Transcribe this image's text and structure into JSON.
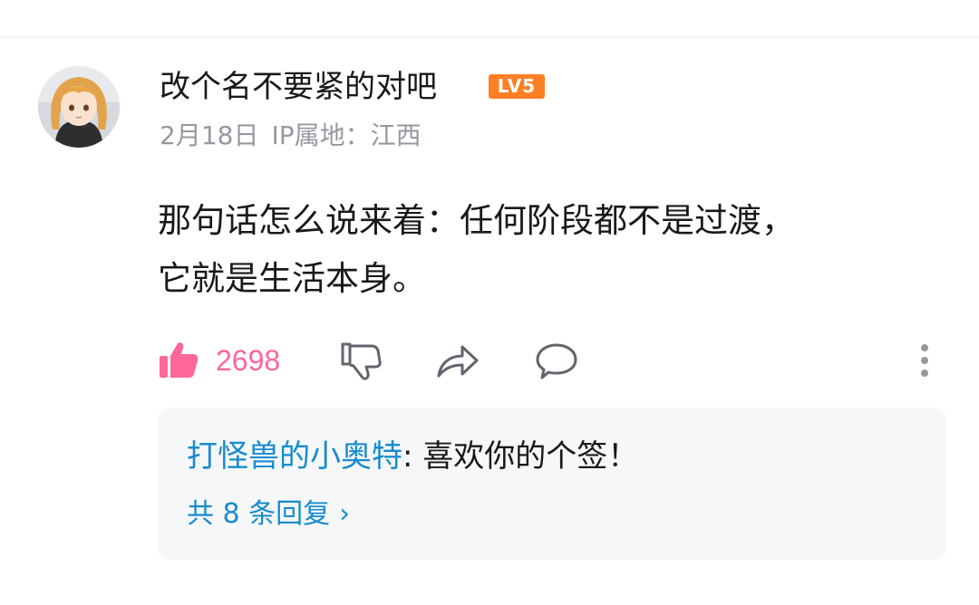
{
  "comment": {
    "username": "改个名不要紧的对吧",
    "level_badge": "LV5",
    "date": "2月18日",
    "ip_location": "IP属地：江西",
    "text_line1": "那句话怎么说来着：任何阶段都不是过渡，",
    "text_line2": "它就是生活本身。",
    "like_count": "2698"
  },
  "colors": {
    "like_pink": "#ff6699",
    "link_blue": "#178bcf",
    "level_orange": "#ff7f24"
  },
  "replies": {
    "author": "打怪兽的小奥特",
    "separator": ":",
    "text": " 喜欢你的个签！",
    "more_label": "共 8 条回复",
    "more_chevron": "›"
  },
  "icons": {
    "like": "thumbs-up-icon",
    "dislike": "thumbs-down-icon",
    "share": "share-icon",
    "reply": "comment-icon",
    "more": "more-vertical-icon"
  }
}
